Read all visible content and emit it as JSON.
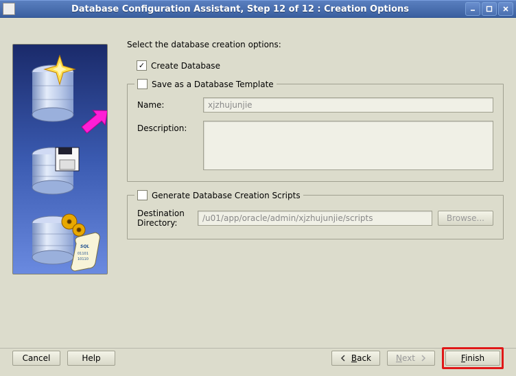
{
  "window": {
    "title": "Database Configuration Assistant, Step 12 of 12 : Creation Options"
  },
  "intro": "Select the database creation options:",
  "create_db": {
    "label": "Create Database",
    "checked": true
  },
  "template_group": {
    "label": "Save as a Database Template",
    "checked": false,
    "name_label": "Name:",
    "name_value": "xjzhujunjie",
    "desc_label": "Description:",
    "desc_value": ""
  },
  "scripts_group": {
    "label": "Generate Database Creation Scripts",
    "checked": false,
    "dest_label": "Destination\nDirectory:",
    "dest_value": "/u01/app/oracle/admin/xjzhujunjie/scripts",
    "browse_label": "Browse..."
  },
  "footer": {
    "cancel": "Cancel",
    "help": "Help",
    "back": "Back",
    "next": "Next",
    "finish": "Finish"
  }
}
